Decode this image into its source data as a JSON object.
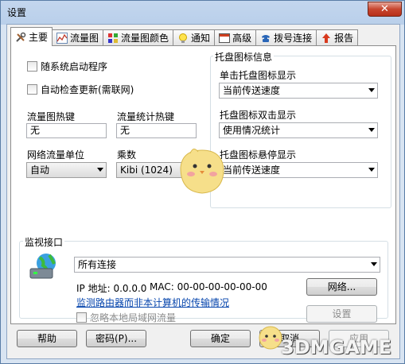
{
  "window": {
    "title": "设置",
    "close_label": "✕"
  },
  "tabs": [
    {
      "label": "主要",
      "icon": "tools-icon",
      "active": true
    },
    {
      "label": "流量图",
      "icon": "line-chart-icon"
    },
    {
      "label": "流量图颜色",
      "icon": "color-grid-icon"
    },
    {
      "label": "通知",
      "icon": "bulb-icon"
    },
    {
      "label": "高级",
      "icon": "window-icon"
    },
    {
      "label": "拨号连接",
      "icon": "phone-icon"
    },
    {
      "label": "报告",
      "icon": "arrow-up-icon"
    }
  ],
  "main": {
    "run_on_startup": "随系统启动程序",
    "auto_update": "自动检查更新(需联网)",
    "traffic_hotkey_label": "流量图热键",
    "traffic_hotkey_value": "无",
    "stats_hotkey_label": "流量统计热键",
    "stats_hotkey_value": "无",
    "unit_label": "网络流量单位",
    "unit_value": "自动",
    "multiplier_label": "乘数",
    "multiplier_value": "Kibi (1024)",
    "tray": {
      "title": "托盘图标信息",
      "click_label": "单击托盘图标显示",
      "click_value": "当前传送速度",
      "dblclick_label": "托盘图标双击显示",
      "dblclick_value": "使用情况统计",
      "hover_label": "托盘图标悬停显示",
      "hover_value": "当前传送速度"
    },
    "monitor": {
      "title": "监视接口",
      "interface_value": "所有连接",
      "ip_text": "IP 地址: 0.0.0.0",
      "mac_text": "MAC: 00-00-00-00-00-00",
      "network_button": "网络...",
      "router_link": "监测路由器而非本计算机的传输情况",
      "settings_button": "设置",
      "ignore_local": "忽略本地局域网流量"
    }
  },
  "footer": {
    "help": "帮助",
    "password": "密码(P)...",
    "ok": "确定",
    "cancel": "取消",
    "apply": "应用"
  },
  "watermark": "3DMGAME"
}
